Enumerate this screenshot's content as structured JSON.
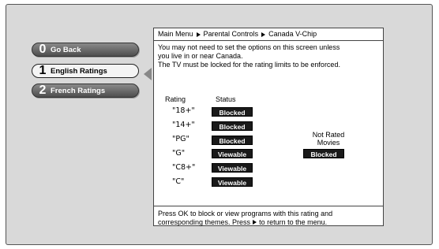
{
  "menu": {
    "items": [
      {
        "num": "0",
        "label": "Go Back"
      },
      {
        "num": "1",
        "label": "English Ratings"
      },
      {
        "num": "2",
        "label": "French Ratings"
      }
    ]
  },
  "breadcrumb": {
    "items": [
      "Main Menu",
      "Parental Controls",
      "Canada V-Chip"
    ]
  },
  "description": {
    "line1": "You may not need to set the options on this screen unless",
    "line2": "you live in or near Canada.",
    "line3": "The TV must be locked for the rating limits to be enforced."
  },
  "table": {
    "rating_header": "Rating",
    "status_header": "Status",
    "rows": [
      {
        "rating": "\"18+\"",
        "status": "Blocked"
      },
      {
        "rating": "\"14+\"",
        "status": "Blocked"
      },
      {
        "rating": "\"PG\"",
        "status": "Blocked"
      },
      {
        "rating": "\"G\"",
        "status": "Viewable"
      },
      {
        "rating": "\"C8+\"",
        "status": "Viewable"
      },
      {
        "rating": "\"C\"",
        "status": "Viewable"
      }
    ]
  },
  "not_rated": {
    "line1": "Not Rated",
    "line2": "Movies",
    "status": "Blocked"
  },
  "footer": {
    "line1": "Press OK to block or view programs with this rating and",
    "line2a": "corresponding themes. Press",
    "line2b": "to return to the menu."
  }
}
